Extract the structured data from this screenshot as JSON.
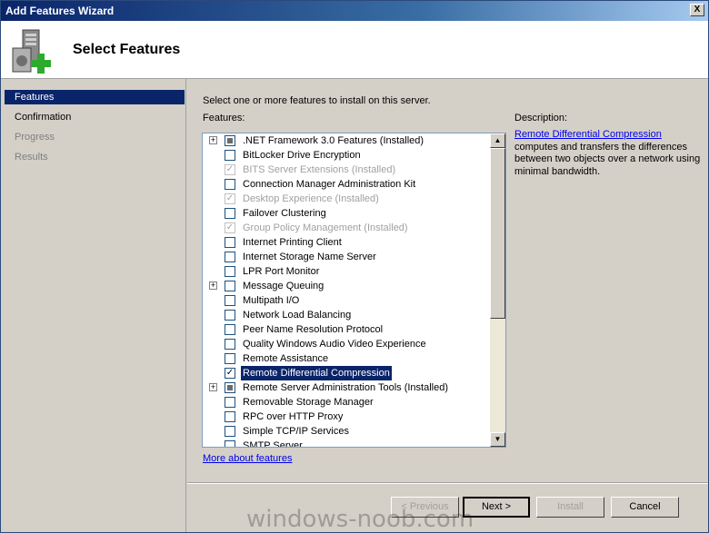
{
  "window": {
    "title": "Add Features Wizard",
    "close_label": "X"
  },
  "header": {
    "title": "Select Features",
    "icon": "server-add-icon"
  },
  "sidebar": {
    "items": [
      {
        "label": "Features",
        "state": "active"
      },
      {
        "label": "Confirmation",
        "state": "normal"
      },
      {
        "label": "Progress",
        "state": "disabled"
      },
      {
        "label": "Results",
        "state": "disabled"
      }
    ]
  },
  "main": {
    "instruction": "Select one or more features to install on this server.",
    "features_label": "Features:",
    "more_link": "More about features"
  },
  "features": [
    {
      "label": ".NET Framework 3.0 Features  (Installed)",
      "expander": true,
      "check": "partial",
      "disabled": false
    },
    {
      "label": "BitLocker Drive Encryption",
      "expander": false,
      "check": "none",
      "disabled": false
    },
    {
      "label": "BITS Server Extensions  (Installed)",
      "expander": false,
      "check": "checked",
      "disabled": true
    },
    {
      "label": "Connection Manager Administration Kit",
      "expander": false,
      "check": "none",
      "disabled": false
    },
    {
      "label": "Desktop Experience  (Installed)",
      "expander": false,
      "check": "checked",
      "disabled": true
    },
    {
      "label": "Failover Clustering",
      "expander": false,
      "check": "none",
      "disabled": false
    },
    {
      "label": "Group Policy Management  (Installed)",
      "expander": false,
      "check": "checked",
      "disabled": true
    },
    {
      "label": "Internet Printing Client",
      "expander": false,
      "check": "none",
      "disabled": false
    },
    {
      "label": "Internet Storage Name Server",
      "expander": false,
      "check": "none",
      "disabled": false
    },
    {
      "label": "LPR Port Monitor",
      "expander": false,
      "check": "none",
      "disabled": false
    },
    {
      "label": "Message Queuing",
      "expander": true,
      "check": "none",
      "disabled": false
    },
    {
      "label": "Multipath I/O",
      "expander": false,
      "check": "none",
      "disabled": false
    },
    {
      "label": "Network Load Balancing",
      "expander": false,
      "check": "none",
      "disabled": false
    },
    {
      "label": "Peer Name Resolution Protocol",
      "expander": false,
      "check": "none",
      "disabled": false
    },
    {
      "label": "Quality Windows Audio Video Experience",
      "expander": false,
      "check": "none",
      "disabled": false
    },
    {
      "label": "Remote Assistance",
      "expander": false,
      "check": "none",
      "disabled": false
    },
    {
      "label": "Remote Differential Compression",
      "expander": false,
      "check": "checked",
      "disabled": false,
      "selected": true
    },
    {
      "label": "Remote Server Administration Tools  (Installed)",
      "expander": true,
      "check": "partial",
      "disabled": false
    },
    {
      "label": "Removable Storage Manager",
      "expander": false,
      "check": "none",
      "disabled": false
    },
    {
      "label": "RPC over HTTP Proxy",
      "expander": false,
      "check": "none",
      "disabled": false
    },
    {
      "label": "Simple TCP/IP Services",
      "expander": false,
      "check": "none",
      "disabled": false
    },
    {
      "label": "SMTP Server",
      "expander": false,
      "check": "none",
      "disabled": false
    }
  ],
  "description": {
    "label": "Description:",
    "link": "Remote Differential Compression",
    "text": "computes and transfers the differences between two objects over a network using minimal bandwidth."
  },
  "buttons": {
    "previous": "< Previous",
    "next": "Next >",
    "install": "Install",
    "cancel": "Cancel"
  },
  "watermark": "windows-noob.com",
  "colors": {
    "selection": "#0a246a",
    "link": "#0000ee",
    "titlebar": "#0a246a"
  }
}
